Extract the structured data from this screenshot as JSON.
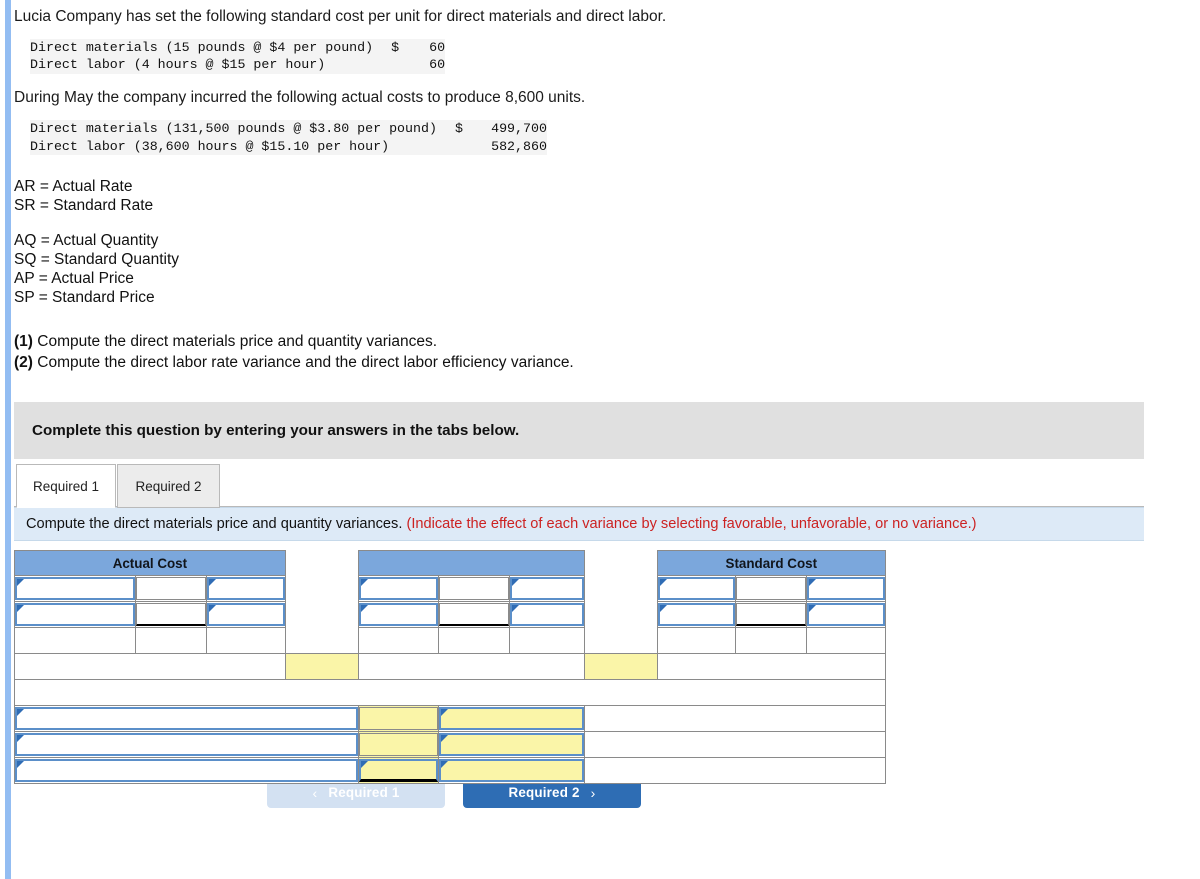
{
  "problem": {
    "intro": "Lucia Company has set the following standard cost per unit for direct materials and direct labor.",
    "standard_rows": [
      {
        "label": "Direct materials (15 pounds @ $4 per pound)",
        "currency": "$",
        "value": "60"
      },
      {
        "label": "Direct labor (4 hours @ $15 per hour)",
        "currency": "",
        "value": "60"
      }
    ],
    "during": "During May the company incurred the following actual costs to produce 8,600 units.",
    "actual_rows": [
      {
        "label": "Direct materials (131,500 pounds @ $3.80 per pound)",
        "currency": "$",
        "value": "499,700"
      },
      {
        "label": "Direct labor (38,600 hours @ $15.10 per hour)",
        "currency": "",
        "value": "582,860"
      }
    ],
    "definitions_group_1": [
      "AR = Actual Rate",
      "SR = Standard Rate"
    ],
    "definitions_group_2": [
      "AQ = Actual Quantity",
      "SQ = Standard Quantity",
      "AP = Actual Price",
      "SP = Standard Price"
    ],
    "requirements": [
      {
        "number": "(1)",
        "text": "Compute the direct materials price and quantity variances."
      },
      {
        "number": "(2)",
        "text": "Compute the direct labor rate variance and the direct labor efficiency variance."
      }
    ]
  },
  "banner": {
    "text": "Complete this question by entering your answers in the tabs below."
  },
  "tabs": [
    {
      "label": "Required 1",
      "active": true
    },
    {
      "label": "Required 2",
      "active": false
    }
  ],
  "instruction": {
    "main": "Compute the direct materials price and quantity variances.",
    "hint": "(Indicate the effect of each variance by selecting favorable, unfavorable, or no variance.)"
  },
  "answer_grid": {
    "headers": {
      "actual_cost": "Actual Cost",
      "middle": "",
      "standard_cost": "Standard Cost"
    },
    "cell_values": {
      "empty": ""
    }
  },
  "nav": {
    "prev_label": "Required 1",
    "prev_chevron": "‹",
    "next_label": "Required 2",
    "next_chevron": "›"
  },
  "colors": {
    "header_blue": "#7ba7dc",
    "input_border_blue": "#5b8fc9",
    "marker_blue": "#2f6cb5",
    "yellow_cell": "#faf5a8",
    "banner_gray": "#e0e0e0",
    "instruction_blue": "#ddeaf7",
    "hint_red": "#cc2222",
    "button_active": "#2e6db4",
    "button_disabled": "#d3e1f2",
    "left_rail": "#93bdf2"
  }
}
